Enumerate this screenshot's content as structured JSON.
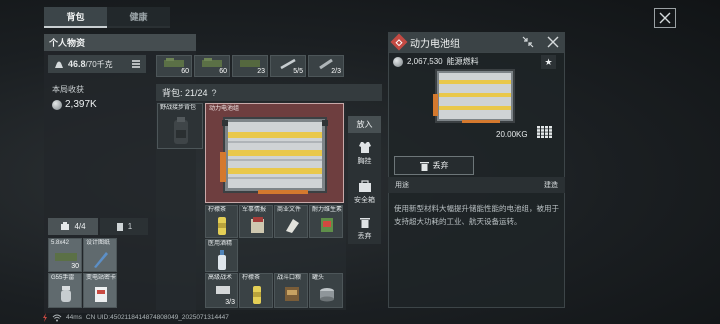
{
  "tabs": [
    {
      "label": "背包",
      "active": true
    },
    {
      "label": "健康",
      "active": false
    }
  ],
  "personal": {
    "title": "个人物资",
    "weight_value": "46.8",
    "weight_max": "/70千克",
    "income_label": "本局收获",
    "income_value": "2,397K"
  },
  "gear_slots": [
    {
      "count": "60"
    },
    {
      "count": "60"
    },
    {
      "count": "23"
    },
    {
      "count": "5/5"
    },
    {
      "count": "2/3"
    }
  ],
  "backpack": {
    "label": "背包: 21/24",
    "help": "?"
  },
  "backpack_items": [
    {
      "name": "野战接步背包"
    },
    {
      "name": "动力电池组"
    },
    {
      "name": "柠檬茶"
    },
    {
      "name": "军事情报"
    },
    {
      "name": "商业文件"
    },
    {
      "name": "耐力维生素"
    },
    {
      "name": "医用酒精"
    },
    {
      "name": "高级战术",
      "count": "3/3"
    },
    {
      "name": "柠檬茶"
    },
    {
      "name": "战斗口粮"
    },
    {
      "name": "罐头"
    }
  ],
  "pocket": {
    "tab_a": "4/4",
    "tab_b": "1",
    "items": [
      {
        "name": "5.8x42",
        "count": "30"
      },
      {
        "name": "设计图纸"
      },
      {
        "name": "G55手雷"
      },
      {
        "name": "变电站密卡"
      }
    ]
  },
  "actions": {
    "header": "放入",
    "items": [
      {
        "label": "胸挂",
        "icon": "vest-icon"
      },
      {
        "label": "安全箱",
        "icon": "safe-box-icon"
      },
      {
        "label": "丢弃",
        "icon": "trash-icon"
      }
    ]
  },
  "detail": {
    "title": "动力电池组",
    "price": "2,067,530",
    "category": "能源燃料",
    "star": "★",
    "weight": "20.00KG",
    "drop_label": "丢弃",
    "usage_label": "用途",
    "usage_value": "建造",
    "description": "使用新型材料大幅提升储能性能的电池组，被用于支持超大功耗的工业、航天设备运转。"
  },
  "footer": {
    "ping": "44ms",
    "uid": "CN UID:4502118414874808049_2025071314447"
  },
  "colors": {
    "accent_red": "#c44a43",
    "selected_slot": "#6e3e3f",
    "battery_yellow": "#e9c84b"
  }
}
